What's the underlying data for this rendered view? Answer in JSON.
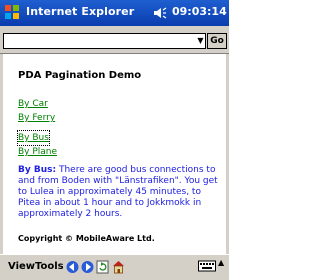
{
  "statusbar": {
    "app_title": "Internet Explorer",
    "time": "09:03:14",
    "logo_icon": "windows-flag-icon",
    "volume_icon": "speaker-icon"
  },
  "address_bar": {
    "url_value": "",
    "dropdown_icon": "chevron-down-icon",
    "go_label": "Go"
  },
  "page": {
    "title": "PDA Pagination Demo",
    "links": [
      {
        "label": "By Car"
      },
      {
        "label": "By Ferry"
      },
      {
        "label": "By Bus"
      },
      {
        "label": "By Plane"
      }
    ],
    "bus_label": "By Bus:",
    "bus_text": " There are good bus connections to and from Boden with \"Länstrafiken\". You get to Lulea in approximately 45 minutes, to Pitea in about 1 hour and to Jokkmokk in approximately 2 hours.",
    "copyright": "Copyright © MobileAware Ltd."
  },
  "toolbar": {
    "view_label": "View",
    "tools_label": "Tools",
    "icons": [
      "back-arrow-icon",
      "forward-arrow-icon",
      "refresh-icon",
      "home-icon",
      "keyboard-icon"
    ]
  },
  "colors": {
    "titlebar": "#0a3cae",
    "chrome": "#d4d0c8",
    "link": "#008000",
    "body_text": "#2020e0"
  }
}
